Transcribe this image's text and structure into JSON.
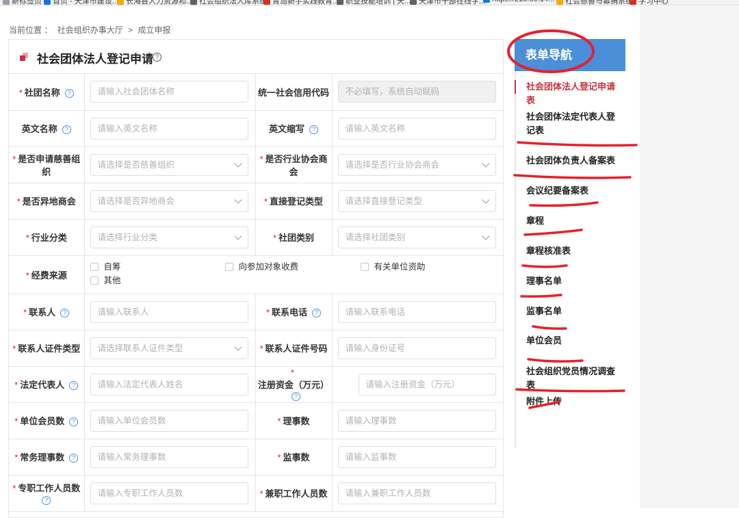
{
  "browser": {
    "bookmarks": [
      {
        "label": "新标签页",
        "color": "#9aa0a6"
      },
      {
        "label": "首页 - 天津市建设...",
        "color": "#1a73e8"
      },
      {
        "label": "长海县人力资源和...",
        "color": "#f9ab00"
      },
      {
        "label": "社会组织法人库系统",
        "color": "#5f6368"
      },
      {
        "label": "青岛新手实践教育...",
        "color": "#d93025"
      },
      {
        "label": "职业技能培训 | 天...",
        "color": "#5f6368"
      },
      {
        "label": "天津市干部在线学...",
        "color": "#5f6368"
      },
      {
        "label": "https://218.60.14...",
        "color": "#1a73e8"
      },
      {
        "label": "社会慈善与募捐系统",
        "color": "#f9ab00"
      },
      {
        "label": "学习中心",
        "color": "#d93025"
      }
    ]
  },
  "breadcrumb": {
    "prefix": "当前位置 ：",
    "level1": "社会组织办事大厅",
    "sep": ">",
    "level2": "成立申报"
  },
  "form": {
    "title": "社会团体法人登记申请",
    "rows": [
      {
        "l_label": "社团名称",
        "l_req": true,
        "l_help": true,
        "l_type": "input",
        "l_ph": "请输入社会团体名称",
        "r_label": "统一社会信用代码",
        "r_req": false,
        "r_help": false,
        "r_type": "input-disabled",
        "r_ph": "不必填写，系统自动赋码"
      },
      {
        "l_label": "英文名称",
        "l_req": false,
        "l_help": true,
        "l_type": "input",
        "l_ph": "请输入英文名称",
        "r_label": "英文缩写",
        "r_req": false,
        "r_help": true,
        "r_type": "input",
        "r_ph": "请输入英文名称"
      },
      {
        "l_label": "是否申请慈善组织",
        "l_req": true,
        "l_help": false,
        "l_type": "select",
        "l_ph": "请选择是否慈善组织",
        "r_label": "是否行业协会商会",
        "r_req": true,
        "r_help": false,
        "r_type": "select",
        "r_ph": "请选择是否行业协会商会"
      },
      {
        "l_label": "是否异地商会",
        "l_req": true,
        "l_help": false,
        "l_type": "select",
        "l_ph": "请选择是否异地商会",
        "r_label": "直接登记类型",
        "r_req": true,
        "r_help": false,
        "r_type": "select",
        "r_ph": "请选择直接登记类型"
      },
      {
        "l_label": "行业分类",
        "l_req": true,
        "l_help": false,
        "l_type": "select",
        "l_ph": "请选择行业分类",
        "r_label": "社团类别",
        "r_req": true,
        "r_help": false,
        "r_type": "select",
        "r_ph": "请选择社团类别"
      },
      {
        "l_label": "联系人",
        "l_req": true,
        "l_help": true,
        "l_type": "input",
        "l_ph": "请输入联系人",
        "r_label": "联系电话",
        "r_req": true,
        "r_help": true,
        "r_type": "input",
        "r_ph": "请输入联系电话"
      },
      {
        "l_label": "联系人证件类型",
        "l_req": true,
        "l_help": false,
        "l_type": "select",
        "l_ph": "请选择联系人证件类型",
        "r_label": "联系人证件号码",
        "r_req": true,
        "r_help": false,
        "r_type": "input",
        "r_ph": "请输入身份证号"
      },
      {
        "l_label": "法定代表人",
        "l_req": true,
        "l_help": true,
        "l_type": "input",
        "l_ph": "请输入法定代表人姓名",
        "r_label": "注册资金（万元）",
        "r_req": true,
        "r_help": true,
        "r_type": "input",
        "r_ph": "请输入注册资金（万元）"
      },
      {
        "l_label": "单位会员数",
        "l_req": true,
        "l_help": true,
        "l_type": "input",
        "l_ph": "请输入单位会员数",
        "r_label": "理事数",
        "r_req": true,
        "r_help": false,
        "r_type": "input",
        "r_ph": "请输入理事数"
      },
      {
        "l_label": "常务理事数",
        "l_req": true,
        "l_help": true,
        "l_type": "input",
        "l_ph": "请输入常务理事数",
        "r_label": "监事数",
        "r_req": true,
        "r_help": false,
        "r_type": "input",
        "r_ph": "请输入监事数"
      },
      {
        "l_label": "专职工作人员数",
        "l_req": true,
        "l_help": true,
        "l_type": "input",
        "l_ph": "请输入专职工作人员数",
        "r_label": "兼职工作人员数",
        "r_req": true,
        "r_help": false,
        "r_type": "input",
        "r_ph": "请输入兼职工作人员数"
      }
    ],
    "funding": {
      "label": "经费来源",
      "options": [
        "自筹",
        "向参加对象收费",
        "有关单位资助",
        "其他"
      ]
    }
  },
  "nav": {
    "header": "表单导航",
    "items": [
      {
        "label": "社会团体法人登记申请表",
        "active": true
      },
      {
        "label": "社会团体法定代表人登记表",
        "active": false
      },
      {
        "label": "社会团体负责人备案表",
        "active": false
      },
      {
        "label": "会议纪要备案表",
        "active": false
      },
      {
        "label": "章程",
        "active": false
      },
      {
        "label": "章程核准表",
        "active": false
      },
      {
        "label": "理事名单",
        "active": false
      },
      {
        "label": "监事名单",
        "active": false
      },
      {
        "label": "单位会员",
        "active": false
      },
      {
        "label": "社会组织党员情况调查表",
        "active": false
      },
      {
        "label": "附件上传",
        "active": false
      }
    ]
  },
  "colors": {
    "accent": "#4a8fd8",
    "annotation": "#e8202a",
    "required": "#e02020",
    "active_nav": "#c8323c"
  }
}
